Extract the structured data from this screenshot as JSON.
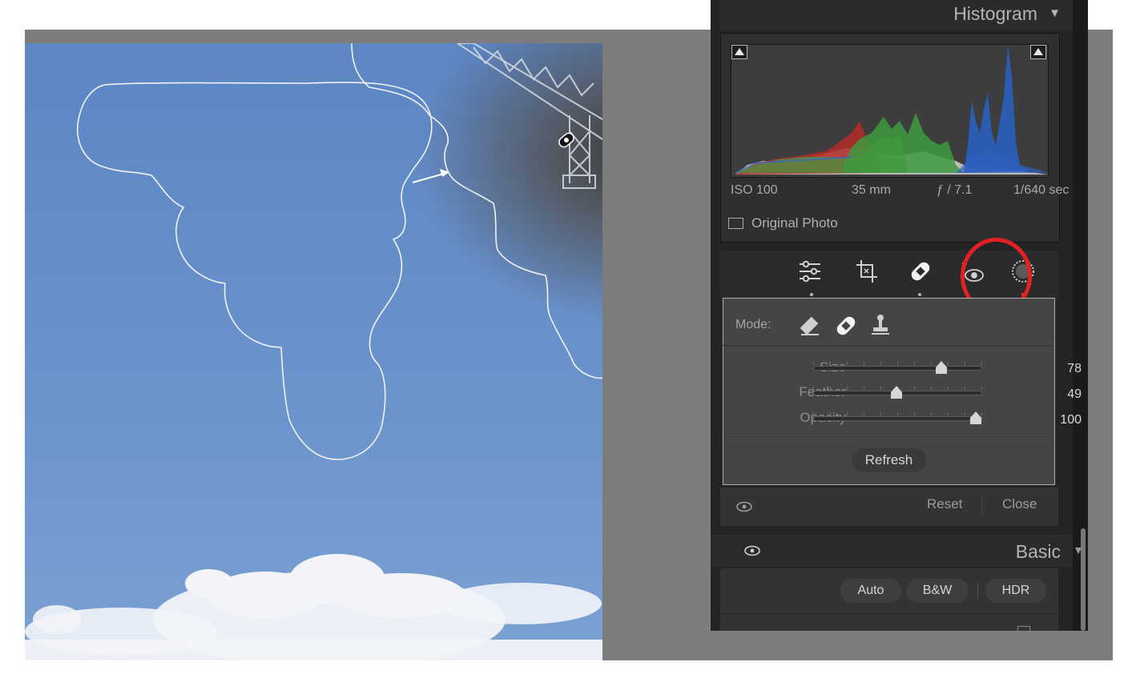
{
  "histogram": {
    "title": "Histogram",
    "exif": {
      "iso": "ISO 100",
      "focal": "35 mm",
      "aperture": "ƒ / 7.1",
      "shutter": "1/640 sec"
    },
    "original_photo_label": "Original Photo"
  },
  "tools": {
    "items": [
      {
        "name": "edit-sliders-icon",
        "active_dot": true
      },
      {
        "name": "crop-icon",
        "active_dot": false
      },
      {
        "name": "healing-icon",
        "active_dot": true
      },
      {
        "name": "red-eye-icon",
        "active_dot": false
      },
      {
        "name": "masking-icon",
        "active_dot": true
      }
    ]
  },
  "healing": {
    "mode_label": "Mode:",
    "sliders": [
      {
        "label": "Size",
        "value": "78",
        "fraction": 0.78
      },
      {
        "label": "Feather",
        "value": "49",
        "fraction": 0.49
      },
      {
        "label": "Opacity",
        "value": "100",
        "fraction": 1.0
      }
    ],
    "refresh_label": "Refresh",
    "reset_label": "Reset",
    "close_label": "Close"
  },
  "basic": {
    "title": "Basic",
    "auto_label": "Auto",
    "bw_label": "B&W",
    "hdr_label": "HDR"
  },
  "colors": {
    "accent_red": "#e32121",
    "panel_bg": "#242424",
    "sky_blue": "#6a93cc"
  }
}
